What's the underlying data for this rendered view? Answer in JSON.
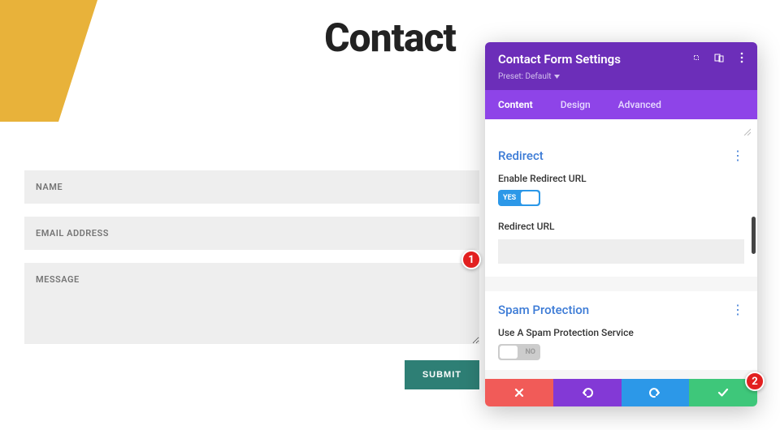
{
  "page": {
    "title": "Contact"
  },
  "form": {
    "name_placeholder": "NAME",
    "email_placeholder": "EMAIL ADDRESS",
    "message_placeholder": "MESSAGE",
    "submit_label": "SUBMIT"
  },
  "panel": {
    "title": "Contact Form Settings",
    "preset_label": "Preset: Default",
    "tabs": {
      "content": "Content",
      "design": "Design",
      "advanced": "Advanced"
    },
    "sections": {
      "redirect": {
        "title": "Redirect",
        "enable_label": "Enable Redirect URL",
        "toggle_state": "YES",
        "url_label": "Redirect URL",
        "url_value": ""
      },
      "spam": {
        "title": "Spam Protection",
        "service_label": "Use A Spam Protection Service",
        "toggle_state": "NO"
      }
    }
  },
  "annotations": {
    "marker1": "1",
    "marker2": "2"
  }
}
